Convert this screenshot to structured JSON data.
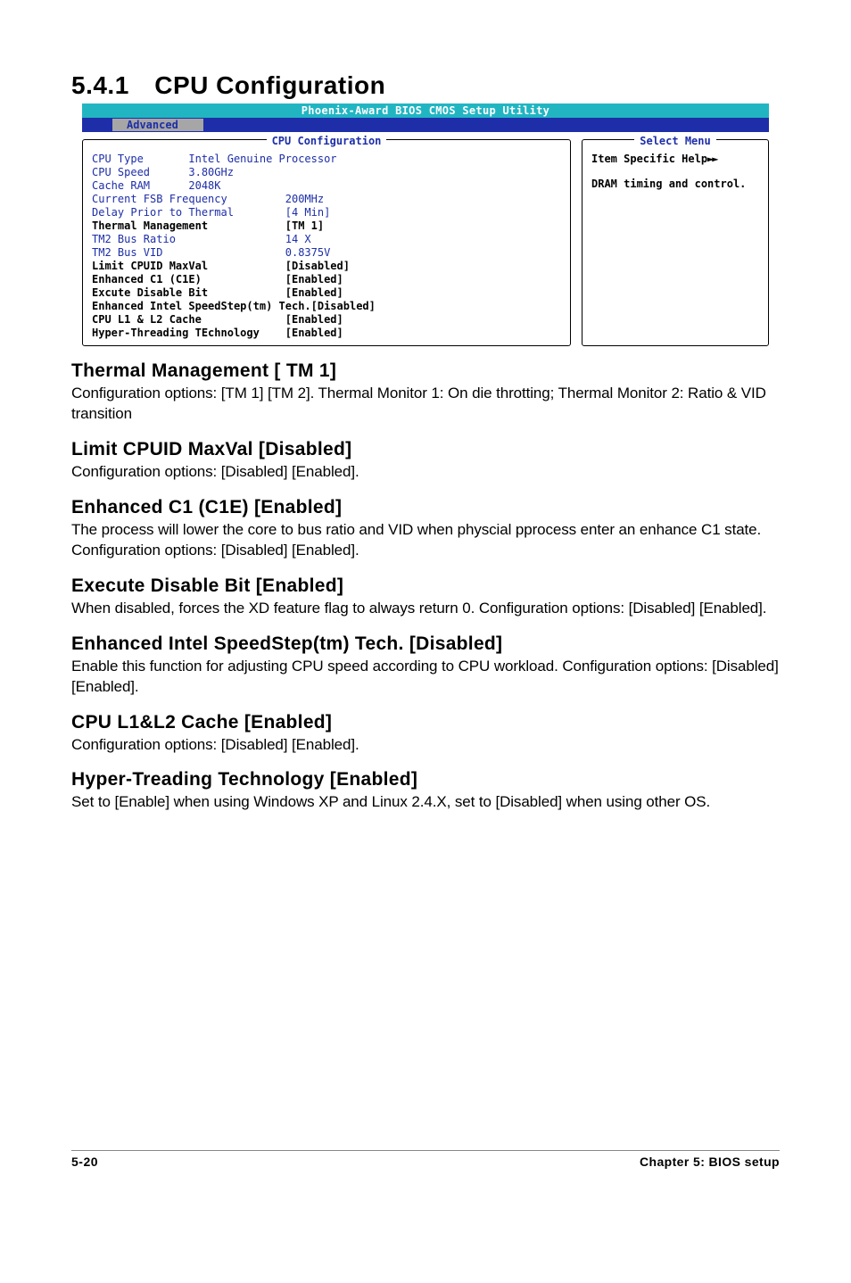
{
  "headings": {
    "section": "5.4.1 CPU Configuration",
    "thermal": "Thermal Management [ TM 1]",
    "limit": "Limit CPUID MaxVal [Disabled]",
    "c1e": "Enhanced C1 (C1E) [Enabled]",
    "exec": "Execute Disable Bit [Enabled]",
    "eist": "Enhanced Intel SpeedStep(tm) Tech. [Disabled]",
    "cache": "CPU L1&L2 Cache [Enabled]",
    "ht": "Hyper-Treading Technology [Enabled]"
  },
  "body": {
    "thermal": "Configuration options: [TM 1] [TM 2]. Thermal Monitor 1: On die throtting; Thermal Monitor 2: Ratio & VID transition",
    "limit": "Configuration options: [Disabled] [Enabled].",
    "c1e": "The process will lower the core to bus ratio and VID when physcial pprocess enter an enhance C1 state. Configuration options: [Disabled] [Enabled].",
    "exec": "When disabled, forces the XD feature flag to always return 0. Configuration options: [Disabled] [Enabled].",
    "eist": "Enable this function for adjusting CPU speed according to CPU workload. Configuration options: [Disabled] [Enabled].",
    "cache": "Configuration options: [Disabled] [Enabled].",
    "ht": "Set to [Enable] when using Windows XP and Linux 2.4.X, set to [Disabled] when using other OS."
  },
  "bios": {
    "title": "Phoenix-Award BIOS CMOS Setup Utility",
    "tab": "Advanced",
    "left_title": "CPU Configuration",
    "right_title": "Select Menu",
    "help1": "Item Specific Help",
    "help2": "DRAM timing and control.",
    "rows": [
      {
        "label": "CPU Type       Intel Genuine Processor",
        "value": "",
        "bold": false
      },
      {
        "label": "CPU Speed      3.80GHz",
        "value": "",
        "bold": false
      },
      {
        "label": "Cache RAM      2048K",
        "value": "",
        "bold": false
      },
      {
        "label": "Current FSB Frequency",
        "value": "200MHz",
        "bold": false
      },
      {
        "label": "Delay Prior to Thermal",
        "value": "[4 Min]",
        "bold": false
      },
      {
        "label": "Thermal Management",
        "value": "[TM 1]",
        "bold": true
      },
      {
        "label": "TM2 Bus Ratio",
        "value": "14 X",
        "bold": false
      },
      {
        "label": "TM2 Bus VID",
        "value": "0.8375V",
        "bold": false
      },
      {
        "label": "Limit CPUID MaxVal",
        "value": "[Disabled]",
        "bold": true
      },
      {
        "label": "Enhanced C1 (C1E)",
        "value": "[Enabled]",
        "bold": true
      },
      {
        "label": "Excute Disable Bit",
        "value": "[Enabled]",
        "bold": true
      },
      {
        "label": "Enhanced Intel SpeedStep(tm) Tech.",
        "value": "[Disabled]",
        "bold": true
      },
      {
        "label": "CPU L1 & L2 Cache",
        "value": "[Enabled]",
        "bold": true
      },
      {
        "label": "Hyper-Threading TEchnology",
        "value": "[Enabled]",
        "bold": true
      }
    ]
  },
  "footer": {
    "page": "5-20",
    "chapter": "Chapter 5: BIOS setup"
  }
}
